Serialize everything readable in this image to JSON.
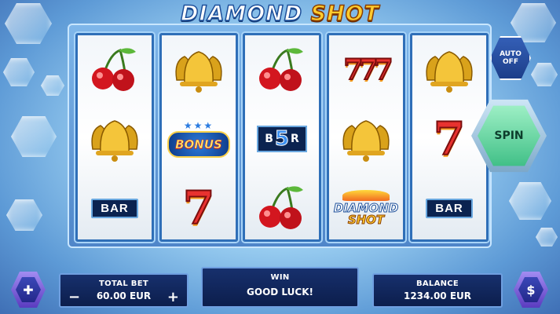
{
  "game": {
    "title_part1": "DIAMOND",
    "title_part2": "SHOT"
  },
  "reels": [
    {
      "symbols": [
        "cherry",
        "bell",
        "bar"
      ],
      "bar_label": "BAR"
    },
    {
      "symbols": [
        "bell",
        "bonus",
        "seven"
      ],
      "bonus_label": "BONUS",
      "seven_label": "7"
    },
    {
      "symbols": [
        "cherry",
        "five-bar",
        "cherry"
      ],
      "five_bar_label_left": "B",
      "five_bar_digit": "5",
      "five_bar_label_right": "R"
    },
    {
      "symbols": [
        "seven-stack",
        "bell",
        "diamond-shot"
      ],
      "seven_label": "777",
      "diamond_label_1": "DIAMOND",
      "diamond_label_2": "SHOT"
    },
    {
      "symbols": [
        "bell",
        "seven",
        "bar"
      ],
      "seven_label": "7",
      "bar_label": "BAR"
    }
  ],
  "controls": {
    "auto_line1": "AUTO",
    "auto_line2": "OFF",
    "spin_label": "SPIN",
    "total_bet_label": "TOTAL BET",
    "total_bet_value": "60.00 EUR",
    "minus": "−",
    "plus": "+",
    "win_label": "WIN",
    "win_value": "GOOD LUCK!",
    "balance_label": "BALANCE",
    "balance_value": "1234.00 EUR"
  },
  "colors": {
    "spin_green": "#3fbf86",
    "panel_navy": "#0c1e4c",
    "title_gold": "#ffcc2e"
  },
  "icons": {
    "left_bottom_button": "plus-hex-icon",
    "right_bottom_button": "coin-settings-icon"
  }
}
